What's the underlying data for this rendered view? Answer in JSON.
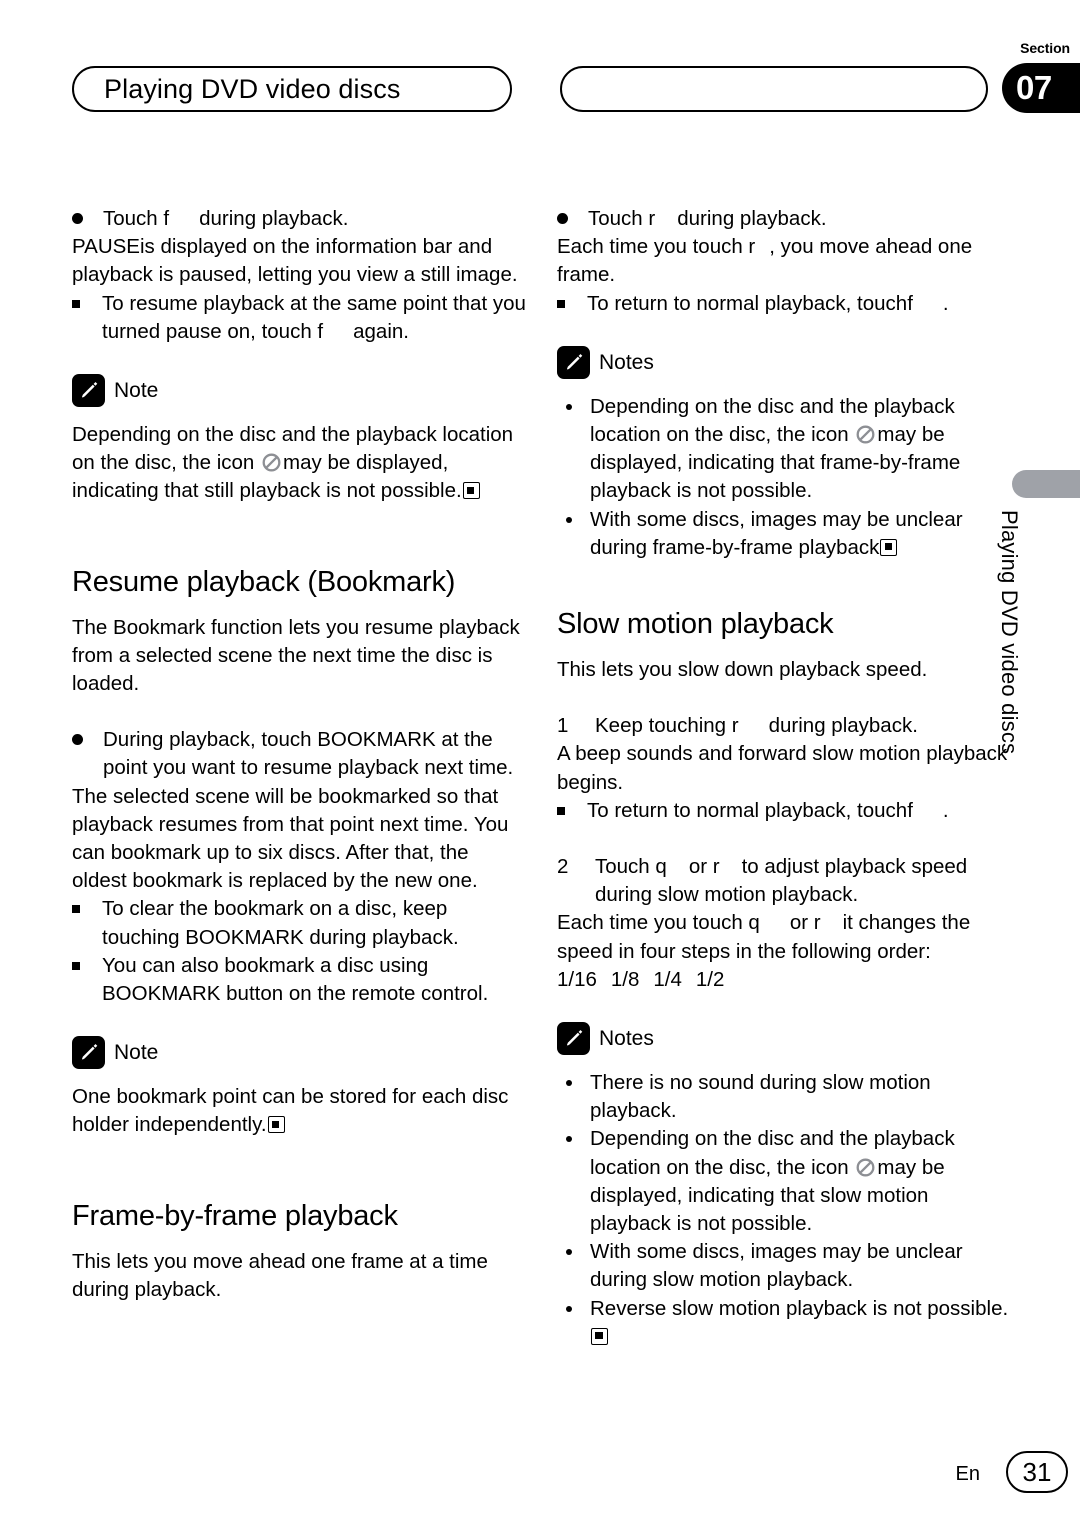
{
  "header": {
    "section_word": "Section",
    "section_number": "07",
    "running_head": "Playing DVD video discs",
    "right_pill_label": ""
  },
  "side_tab": {
    "vertical_title": "Playing DVD video discs"
  },
  "footer": {
    "language": "En",
    "page_number": "31"
  },
  "icons": {
    "pencil": "pencil-icon",
    "prohibited": "prohibited-icon",
    "end_of_note": "end-of-note-icon"
  },
  "left_column": {
    "pause_step": {
      "instruction": "Touch f",
      "instruction_tail": "during playback.",
      "body": "PAUSEis displayed on the information bar and playback is paused, letting you view a still image.",
      "sub_note_a": "To resume playback at the same point that you turned pause on, touch f",
      "sub_note_a_tail": "again."
    },
    "note_1": {
      "label": "Note",
      "text_a": "Depending on the disc and the playback location on the disc, the icon",
      "text_b": "may be displayed, indicating that still playback is not possible."
    },
    "bookmark": {
      "heading": "Resume playback (Bookmark)",
      "intro": "The Bookmark function lets you resume playback from a selected scene the next time the disc is loaded.",
      "step": "During playback, touch BOOKMARK at the point you want to resume playback next time.",
      "step_body": "The selected scene will be bookmarked so that playback resumes from that point next time. You can bookmark up to six discs. After that, the oldest bookmark is replaced by the new one.",
      "sub_note_a": "To clear the bookmark on a disc, keep touching BOOKMARK during playback.",
      "sub_note_b": "You can also bookmark a disc using BOOKMARK button on the remote control."
    },
    "note_2": {
      "label": "Note",
      "text": "One bookmark point can be stored for each disc holder independently."
    },
    "frame_by_frame": {
      "heading": "Frame-by-frame playback",
      "intro": "This lets you move ahead one frame at a time during playback."
    }
  },
  "right_column": {
    "frame_step": {
      "instruction": "Touch r",
      "instruction_tail": "during playback.",
      "body_a": "Each time you touch r",
      "body_b": ", you move ahead one frame.",
      "sub_note": "To return to normal playback, touchf",
      "sub_note_tail": "."
    },
    "notes_1": {
      "label": "Notes",
      "items": [
        {
          "text_a": "Depending on the disc and the playback location on the disc, the icon",
          "text_b": "may be displayed, indicating that frame-by-frame playback is not possible."
        },
        {
          "text_a": "With some discs, images may be unclear during frame-by-frame playback",
          "text_b": ""
        }
      ]
    },
    "slow_motion": {
      "heading": "Slow motion playback",
      "intro": "This lets you slow down playback speed.",
      "step_1_num": "1",
      "step_1": "Keep touching  r",
      "step_1_tail": "during playback.",
      "step_1_body": "A beep sounds and forward slow motion playback begins.",
      "step_1_sub": "To return to normal playback, touchf",
      "step_1_sub_tail": ".",
      "step_2_num": "2",
      "step_2_a": "Touch q",
      "step_2_b": "or r",
      "step_2_c": "to adjust playback speed during slow motion playback.",
      "step_2_body_a": "Each time you touch q",
      "step_2_body_b": "or r",
      "step_2_body_c": "it changes the speed in four steps in the following order:",
      "speeds": [
        "1/16",
        "1/8",
        "1/4",
        "1/2"
      ]
    },
    "notes_2": {
      "label": "Notes",
      "items": [
        {
          "text_a": "There is no sound during slow motion playback.",
          "text_b": ""
        },
        {
          "text_a": "Depending on the disc and the playback location on the disc, the icon",
          "text_b": "may be displayed, indicating that slow motion playback is not possible."
        },
        {
          "text_a": "With some discs, images may be unclear during slow motion playback.",
          "text_b": ""
        },
        {
          "text_a": "Reverse slow motion playback is not possible.",
          "text_b": ""
        }
      ]
    }
  }
}
